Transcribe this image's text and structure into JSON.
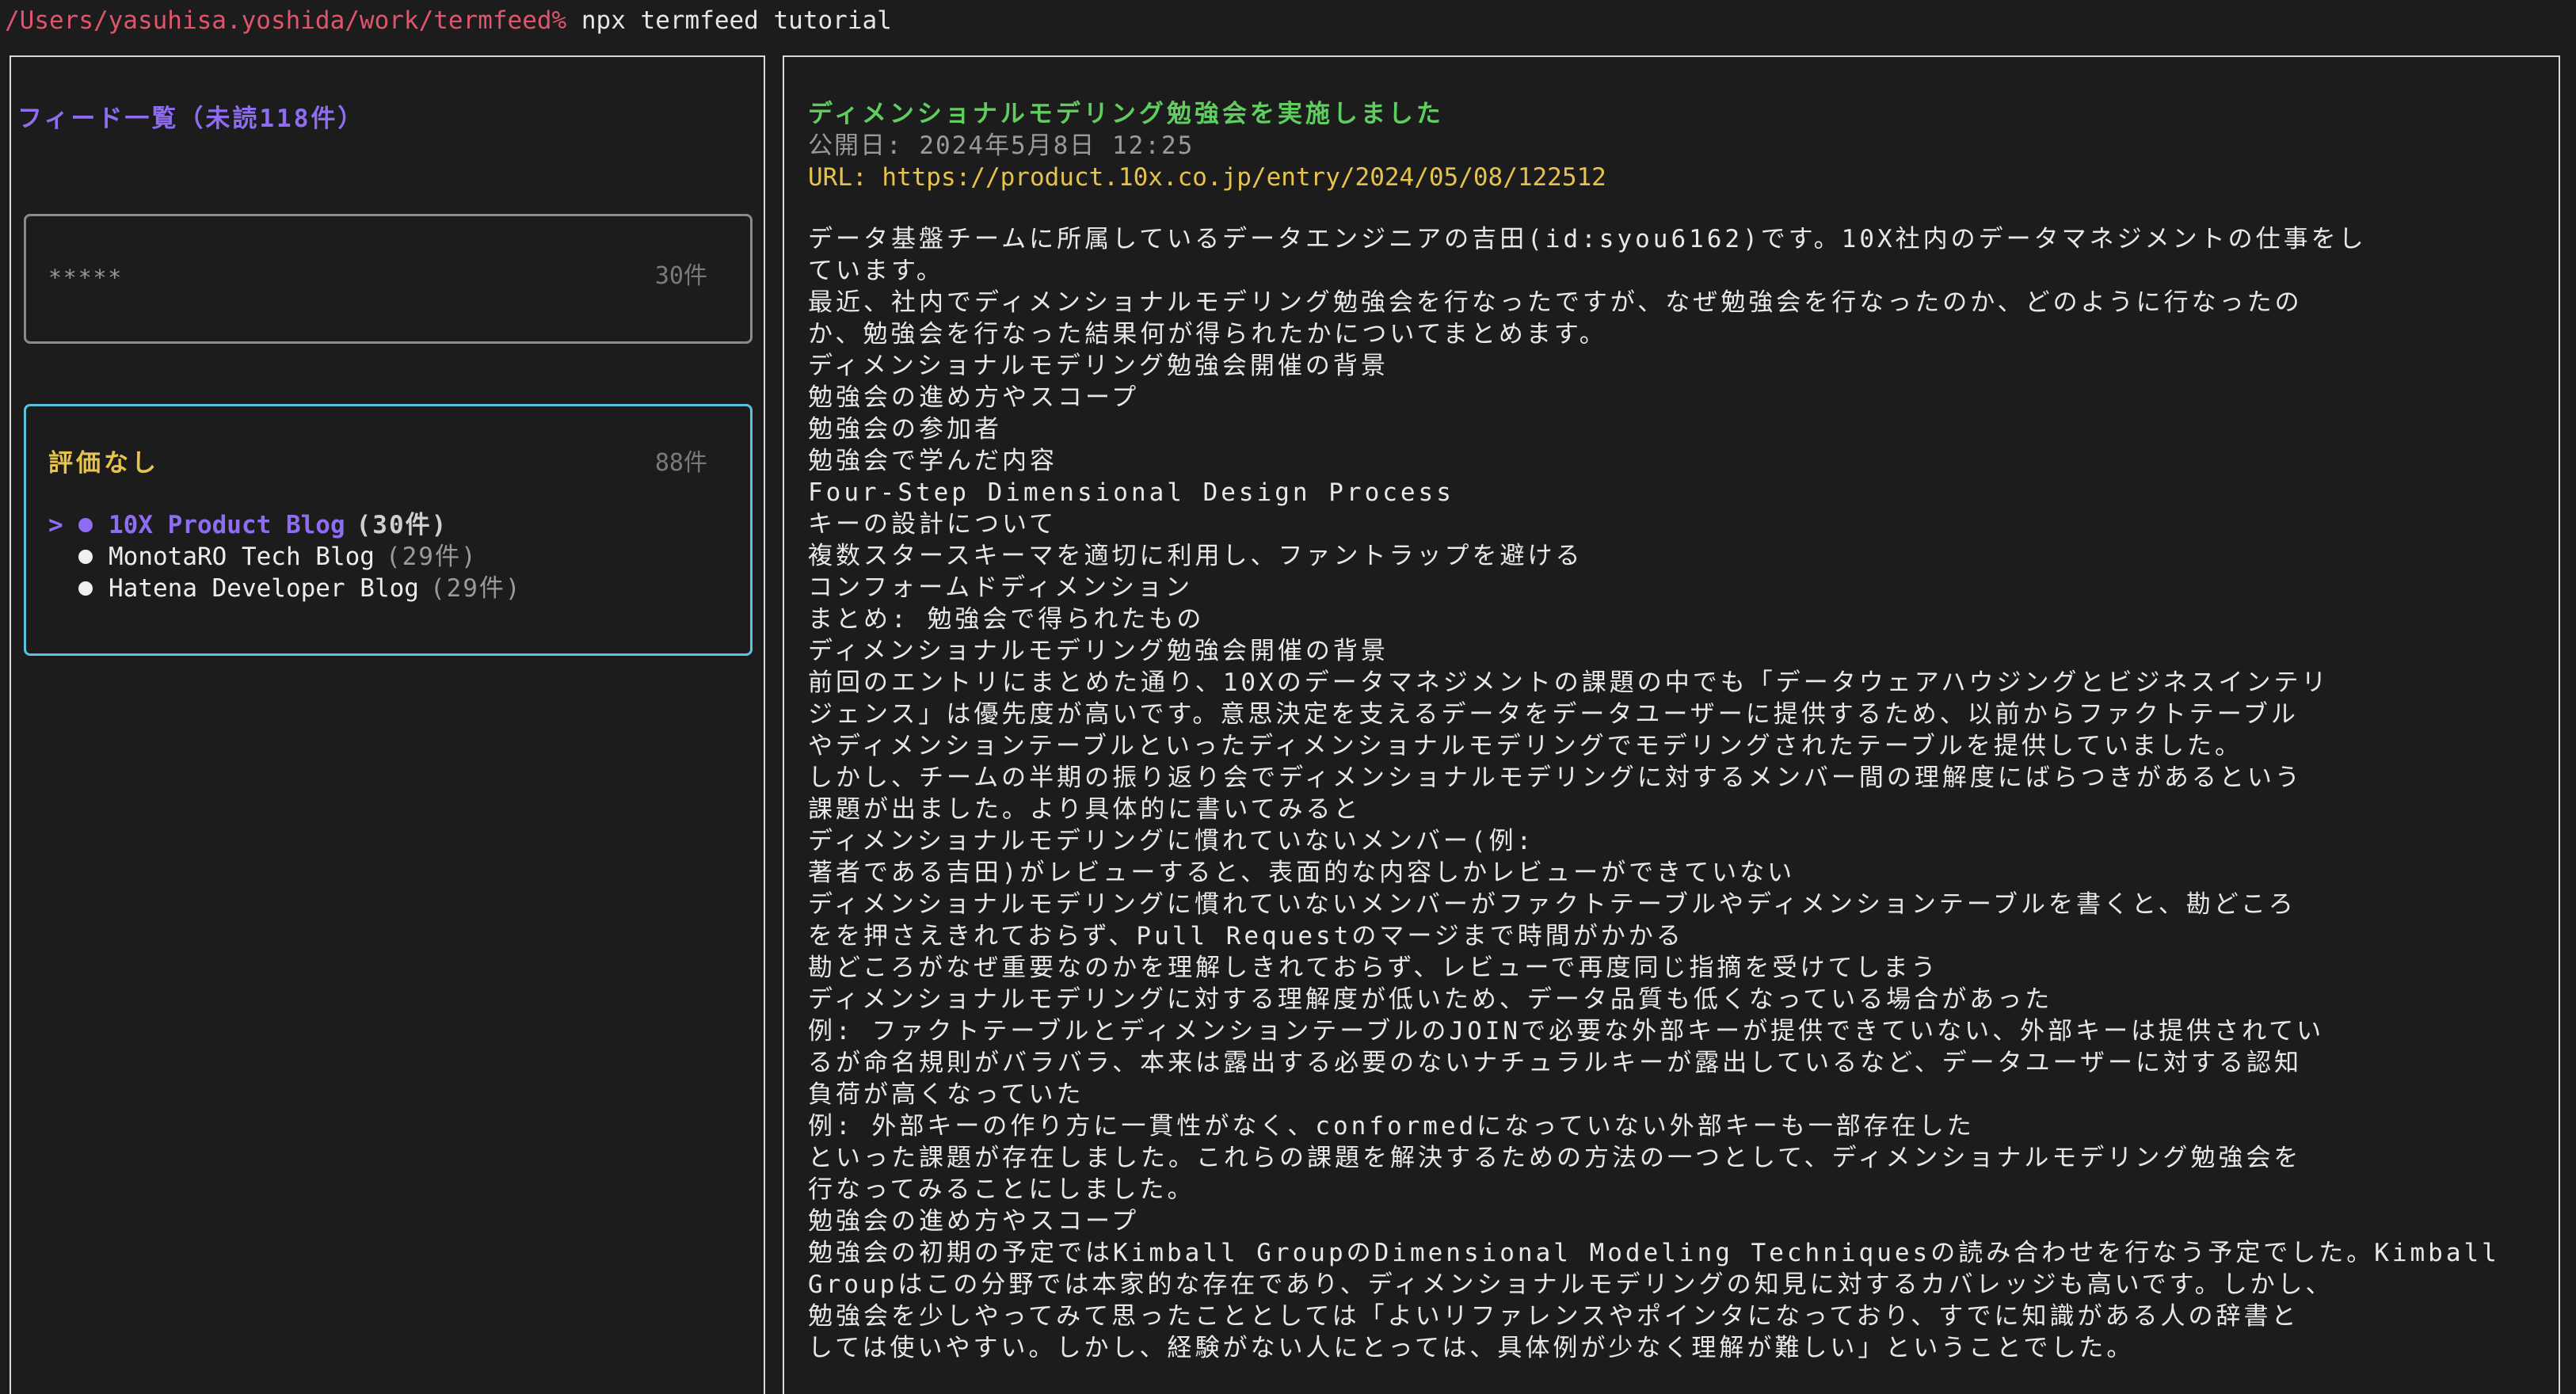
{
  "terminal": {
    "prompt_path": "/Users/yasuhisa.yoshida/work/termfeed%",
    "command": " npx termfeed tutorial"
  },
  "sidebar": {
    "title": "フィード一覧（未読118件）",
    "groups": [
      {
        "label": "*****",
        "count": "30件"
      },
      {
        "label": "評価なし",
        "count": "88件",
        "feeds": [
          {
            "cursor": ">",
            "name": "10X Product Blog",
            "count": "(30件)",
            "selected": true
          },
          {
            "cursor": "",
            "name": "MonotaRO Tech Blog",
            "count": "(29件)",
            "selected": false
          },
          {
            "cursor": "",
            "name": "Hatena Developer Blog",
            "count": "(29件)",
            "selected": false
          }
        ]
      }
    ]
  },
  "article": {
    "title": "ディメンショナルモデリング勉強会を実施しました",
    "published": "公開日: 2024年5月8日 12:25",
    "url": "URL: https://product.10x.co.jp/entry/2024/05/08/122512",
    "lines": [
      "データ基盤チームに所属しているデータエンジニアの吉田(id:syou6162)です。10X社内のデータマネジメントの仕事をし",
      "ています。",
      "最近、社内でディメンショナルモデリング勉強会を行なったですが、なぜ勉強会を行なったのか、どのように行なったの",
      "か、勉強会を行なった結果何が得られたかについてまとめます。",
      "ディメンショナルモデリング勉強会開催の背景",
      "勉強会の進め方やスコープ",
      "勉強会の参加者",
      "勉強会で学んだ内容",
      "Four-Step Dimensional Design Process",
      "キーの設計について",
      "複数スタースキーマを適切に利用し、ファントラップを避ける",
      "コンフォームドディメンション",
      "まとめ: 勉強会で得られたもの",
      "ディメンショナルモデリング勉強会開催の背景",
      "前回のエントリにまとめた通り、10Xのデータマネジメントの課題の中でも「データウェアハウジングとビジネスインテリ",
      "ジェンス」は優先度が高いです。意思決定を支えるデータをデータユーザーに提供するため、以前からファクトテーブル",
      "やディメンションテーブルといったディメンショナルモデリングでモデリングされたテーブルを提供していました。",
      "しかし、チームの半期の振り返り会でディメンショナルモデリングに対するメンバー間の理解度にばらつきがあるという",
      "課題が出ました。より具体的に書いてみると",
      "ディメンショナルモデリングに慣れていないメンバー(例:",
      "著者である吉田)がレビューすると、表面的な内容しかレビューができていない",
      "ディメンショナルモデリングに慣れていないメンバーがファクトテーブルやディメンションテーブルを書くと、勘どころ",
      "をを押さえきれておらず、Pull Requestのマージまで時間がかかる",
      "勘どころがなぜ重要なのかを理解しきれておらず、レビューで再度同じ指摘を受けてしまう",
      "ディメンショナルモデリングに対する理解度が低いため、データ品質も低くなっている場合があった",
      "例: ファクトテーブルとディメンションテーブルのJOINで必要な外部キーが提供できていない、外部キーは提供されてい",
      "るが命名規則がバラバラ、本来は露出する必要のないナチュラルキーが露出しているなど、データユーザーに対する認知",
      "負荷が高くなっていた",
      "例: 外部キーの作り方に一貫性がなく、conformedになっていない外部キーも一部存在した",
      "といった課題が存在しました。これらの課題を解決するための方法の一つとして、ディメンショナルモデリング勉強会を",
      "行なってみることにしました。",
      "勉強会の進め方やスコープ",
      "勉強会の初期の予定ではKimball GroupのDimensional Modeling Techniquesの読み合わせを行なう予定でした。Kimball",
      "Groupはこの分野では本家的な存在であり、ディメンショナルモデリングの知見に対するカバレッジも高いです。しかし、",
      "勉強会を少しやってみて思ったこととしては「よいリファレンスやポインタになっており、すでに知識がある人の辞書と",
      "しては使いやすい。しかし、経験がない人にとっては、具体例が少なく理解が難しい」ということでした。"
    ]
  }
}
